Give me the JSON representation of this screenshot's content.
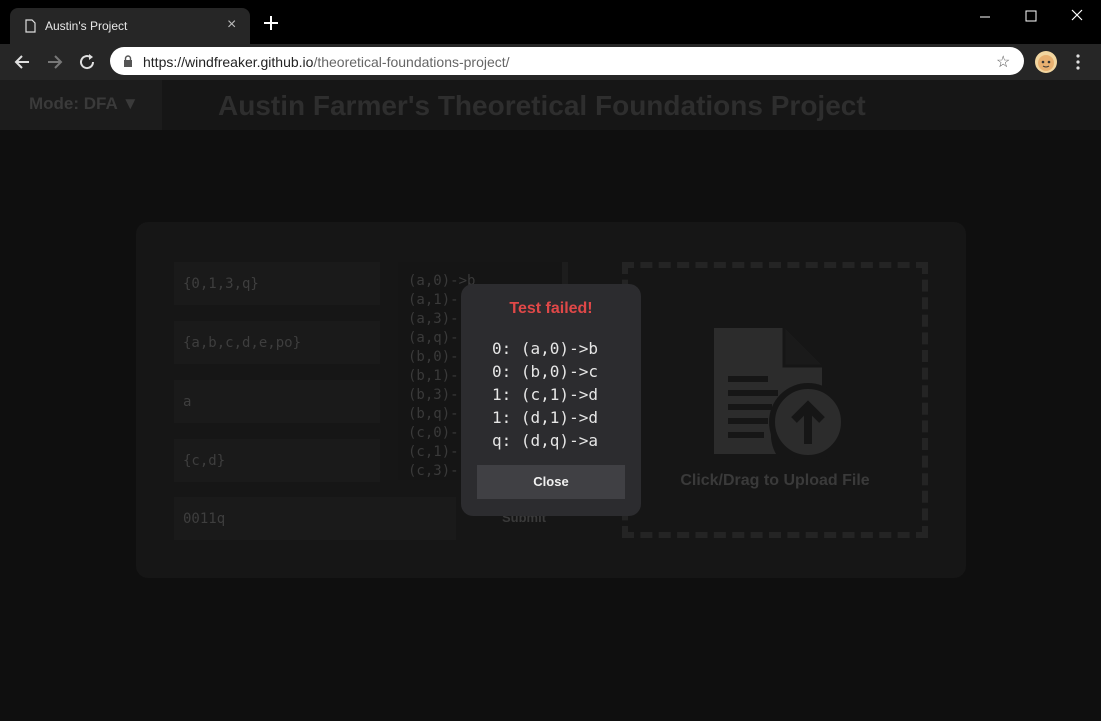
{
  "browser": {
    "tab_title": "Austin's Project",
    "tab_close": "×",
    "url_host": "https://windfreaker.github.io",
    "url_path": "/theoretical-foundations-project/",
    "star": "☆"
  },
  "header": {
    "mode_label": "Mode: DFA ▼",
    "title": "Austin Farmer's Theoretical Foundations Project"
  },
  "form": {
    "alphabet": "{0,1,3,q}",
    "states": "{a,b,c,d,e,po}",
    "start_state": "a",
    "accept_states": "{c,d}",
    "test_string": "0011q",
    "transitions": [
      "(a,0)->b",
      "(a,1)-",
      "(a,3)-",
      "(a,q)-",
      "(b,0)-",
      "(b,1)-",
      "(b,3)-",
      "(b,q)-",
      "(c,0)-",
      "(c,1)-",
      "(c,3)-"
    ],
    "submit_label": "Submit",
    "upload_label": "Click/Drag to Upload File"
  },
  "modal": {
    "title": "Test failed!",
    "lines": [
      "0: (a,0)->b",
      "0: (b,0)->c",
      "1: (c,1)->d",
      "1: (d,1)->d",
      "q: (d,q)->a"
    ],
    "close_label": "Close",
    "title_color": "#e04848"
  }
}
